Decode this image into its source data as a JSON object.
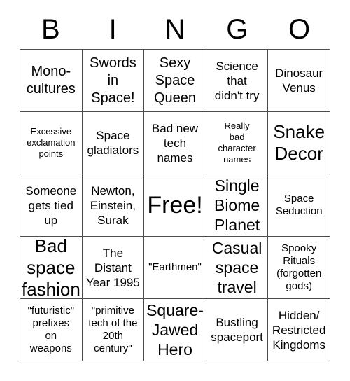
{
  "card": {
    "title": "BINGO",
    "header_letters": [
      "B",
      "I",
      "N",
      "G",
      "O"
    ],
    "border_color": "#4d4d4d",
    "background_color": "#ffffff",
    "text_color": "#000000",
    "rows": 5,
    "columns": 5,
    "cells": [
      {
        "text": "Mono-\ncultures",
        "size": "lg"
      },
      {
        "text": "Swords\nin\nSpace!",
        "size": "lg"
      },
      {
        "text": "Sexy\nSpace\nQueen",
        "size": "lg"
      },
      {
        "text": "Science\nthat\ndidn't try",
        "size": "md"
      },
      {
        "text": "Dinosaur\nVenus",
        "size": "md"
      },
      {
        "text": "Excessive\nexclamation\npoints",
        "size": "xs"
      },
      {
        "text": "Space\ngladiators",
        "size": "md"
      },
      {
        "text": "Bad new\ntech\nnames",
        "size": "md"
      },
      {
        "text": "Really\nbad\ncharacter\nnames",
        "size": "xs"
      },
      {
        "text": "Snake\nDecor",
        "size": "xxl"
      },
      {
        "text": "Someone\ngets tied\nup",
        "size": "md"
      },
      {
        "text": "Newton,\nEinstein,\nSurak",
        "size": "md"
      },
      {
        "text": "Free!",
        "size": "free"
      },
      {
        "text": "Single\nBiome\nPlanet",
        "size": "xl"
      },
      {
        "text": "Space\nSeduction",
        "size": "sm"
      },
      {
        "text": "Bad\nspace\nfashion",
        "size": "xxl"
      },
      {
        "text": "The\nDistant\nYear 1995",
        "size": "md"
      },
      {
        "text": "\"Earthmen\"",
        "size": "sm"
      },
      {
        "text": "Casual\nspace\ntravel",
        "size": "xl"
      },
      {
        "text": "Spooky\nRituals\n(forgotten\ngods)",
        "size": "sm"
      },
      {
        "text": "\"futuristic\"\nprefixes\non\nweapons",
        "size": "sm"
      },
      {
        "text": "\"primitive\ntech of the\n20th\ncentury\"",
        "size": "sm"
      },
      {
        "text": "Square-\nJawed\nHero",
        "size": "xl"
      },
      {
        "text": "Bustling\nspaceport",
        "size": "md"
      },
      {
        "text": "Hidden/\nRestricted\nKingdoms",
        "size": "md"
      }
    ]
  }
}
